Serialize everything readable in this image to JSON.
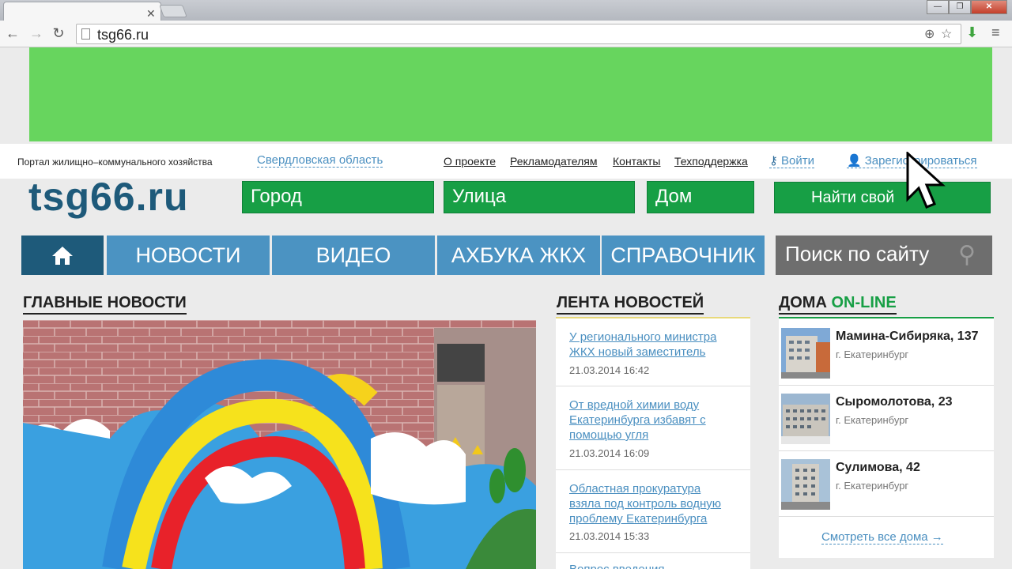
{
  "browser": {
    "url": "tsg66.ru",
    "window_buttons": {
      "minimize": "—",
      "maximize": "❐",
      "close": "✕"
    }
  },
  "header": {
    "tagline": "Портал жилищно–коммунального хозяйства",
    "region": "Свердловская область",
    "links": [
      "О проекте",
      "Рекламодателям",
      "Контакты",
      "Техподдержка"
    ],
    "login": "Войти",
    "register": "Зарегистрироваться",
    "logo": "tsg66.ru"
  },
  "search": {
    "city": "Город",
    "street": "Улица",
    "house": "Дом",
    "find_button": "Найти свой"
  },
  "nav": {
    "items": [
      "НОВОСТИ",
      "ВИДЕО",
      "АХБУКА ЖКХ",
      "СПРАВОЧНИК"
    ],
    "site_search": "Поиск по сайту"
  },
  "main_news": {
    "title": "ГЛАВНЫЕ НОВОСТИ"
  },
  "feed": {
    "title": "ЛЕНТА НОВОСТЕЙ",
    "items": [
      {
        "text": "У регионального министра ЖКХ новый заместитель",
        "date": "21.03.2014 16:42"
      },
      {
        "text": "От вредной химии воду Екатеринбурга избавят с помощью угля",
        "date": "21.03.2014 16:09"
      },
      {
        "text": "Областная прокуратура взяла под контроль водную проблему Екатеринбурга",
        "date": "21.03.2014 15:33"
      },
      {
        "text": "Вопрос введения",
        "date": ""
      }
    ]
  },
  "houses": {
    "title_main": "ДОМА",
    "title_accent": "ON-LINE",
    "items": [
      {
        "name": "Мамина-Сибиряка, 137",
        "city": "г. Екатеринбург"
      },
      {
        "name": "Сыромолотова, 23",
        "city": "г. Екатеринбург"
      },
      {
        "name": "Сулимова, 42",
        "city": "г. Екатеринбург"
      }
    ],
    "see_all": "Смотреть все дома →"
  },
  "colors": {
    "banner": "#67d55e",
    "green": "#179f45",
    "nav_blue": "#4b93c2",
    "nav_home": "#1e5a7a",
    "link": "#4a8fc0"
  }
}
